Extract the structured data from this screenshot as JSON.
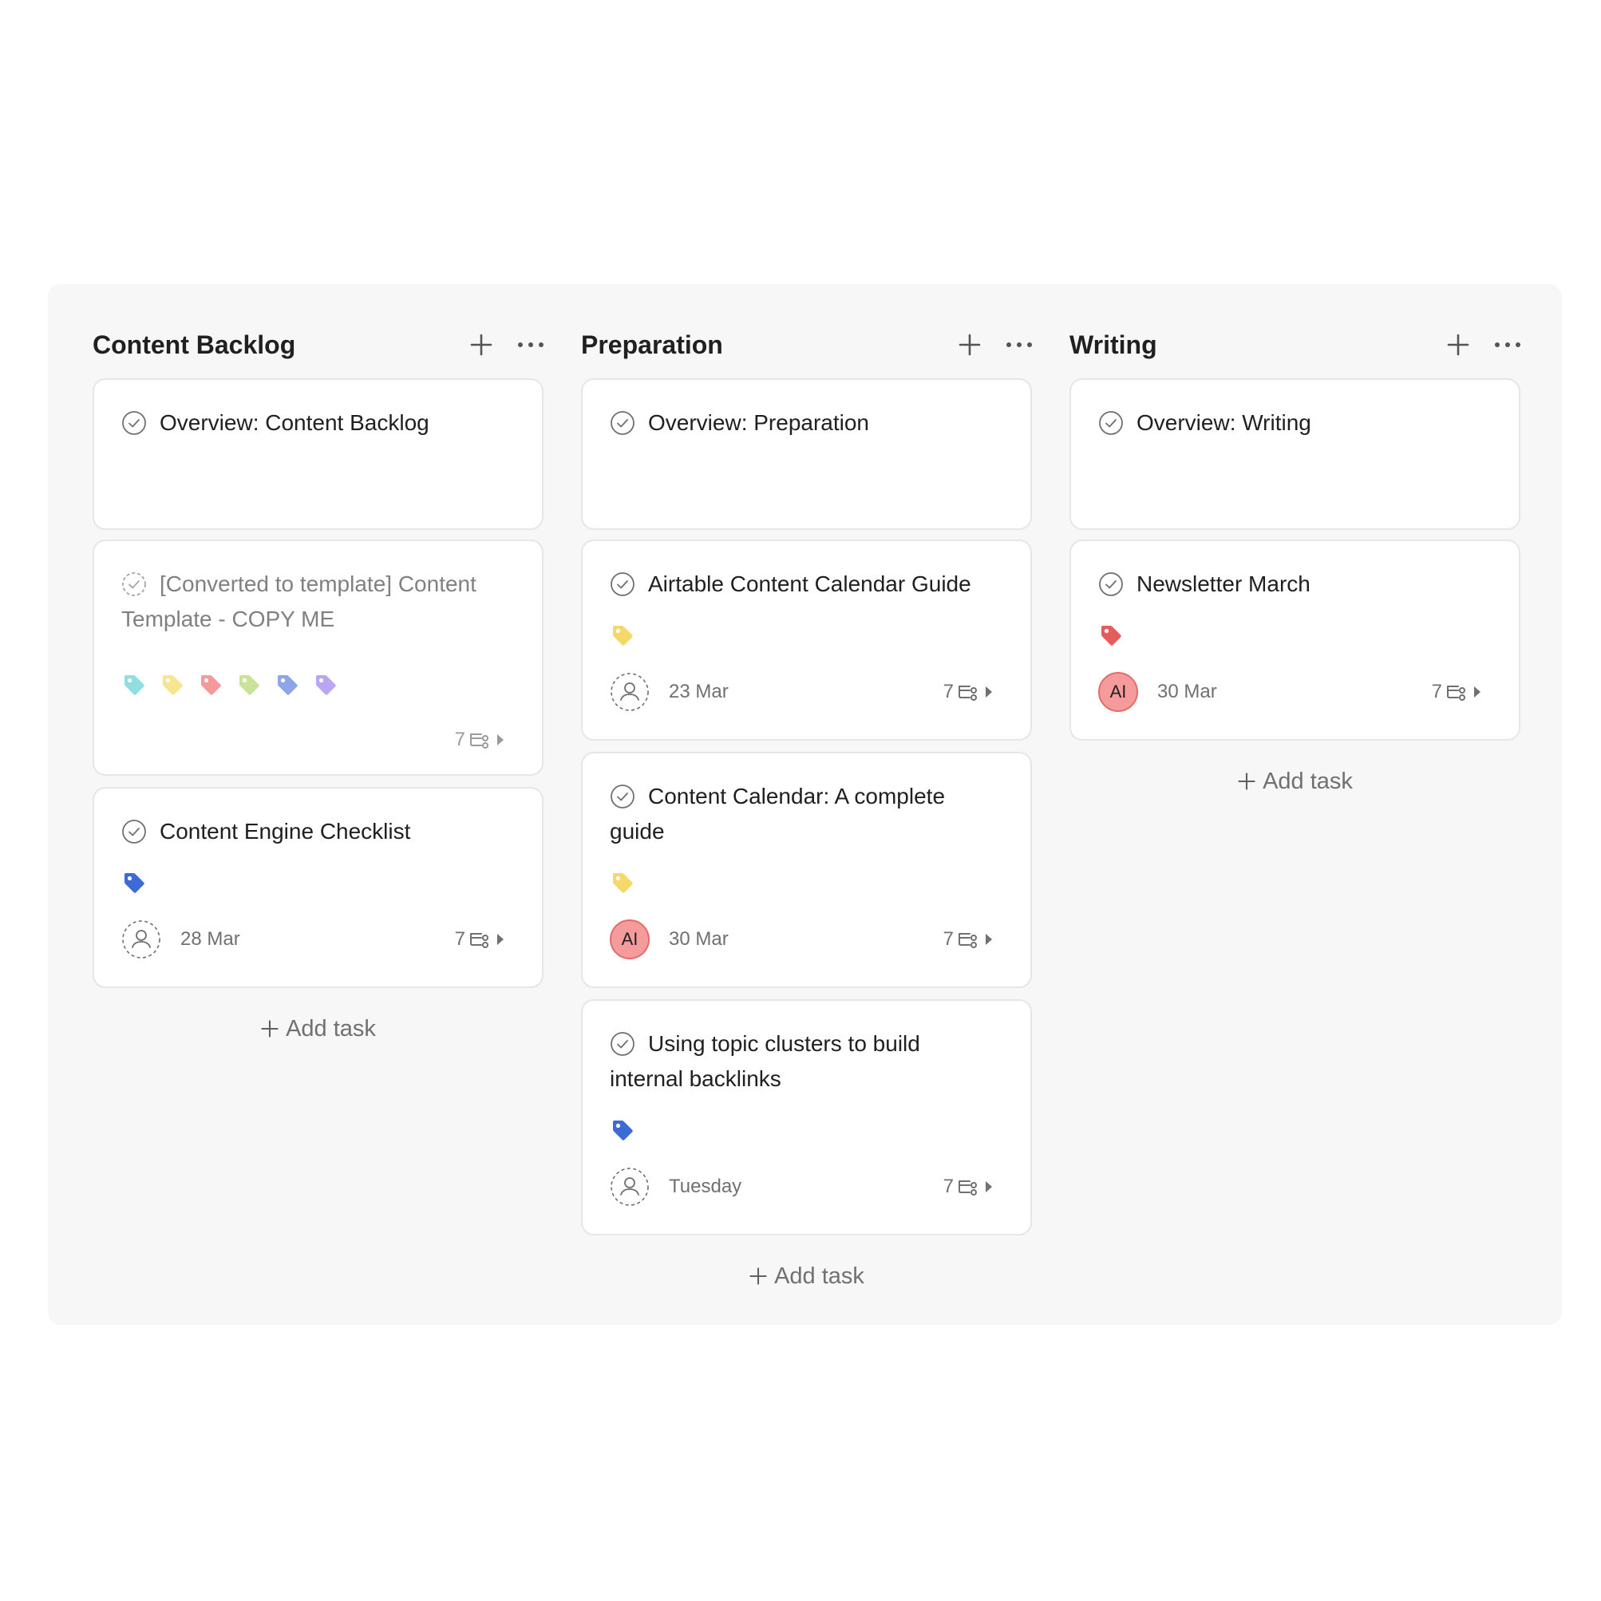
{
  "columns": [
    {
      "title": "Content Backlog",
      "add_task_label": "Add task",
      "cards": [
        {
          "title": "Overview: Content Backlog"
        },
        {
          "title": "[Converted to template] Content Template - COPY ME",
          "subtasks": "7",
          "tag_colors": [
            "#8fdfe0",
            "#f9e58f",
            "#f49a9a",
            "#c9e398",
            "#8ea6e8",
            "#b9a7f2"
          ]
        },
        {
          "title": "Content Engine Checklist",
          "due": "28 Mar",
          "subtasks": "7",
          "tag_color": "#3c6bd5"
        }
      ]
    },
    {
      "title": "Preparation",
      "add_task_label": "Add task",
      "cards": [
        {
          "title": "Overview: Preparation"
        },
        {
          "title": "Airtable Content Calendar Guide",
          "due": "23 Mar",
          "subtasks": "7",
          "tag_color": "#f6d86a"
        },
        {
          "title": "Content Calendar: A complete guide",
          "due": "30 Mar",
          "subtasks": "7",
          "assignee": "AI",
          "tag_color": "#f6d86a"
        },
        {
          "title": "Using topic clusters to build internal backlinks",
          "due": "Tuesday",
          "subtasks": "7",
          "tag_color": "#3c6bd5"
        }
      ]
    },
    {
      "title": "Writing",
      "add_task_label": "Add task",
      "cards": [
        {
          "title": "Overview: Writing"
        },
        {
          "title": "Newsletter March",
          "due": "30 Mar",
          "subtasks": "7",
          "assignee": "AI",
          "tag_color": "#e65b5b"
        }
      ]
    }
  ]
}
